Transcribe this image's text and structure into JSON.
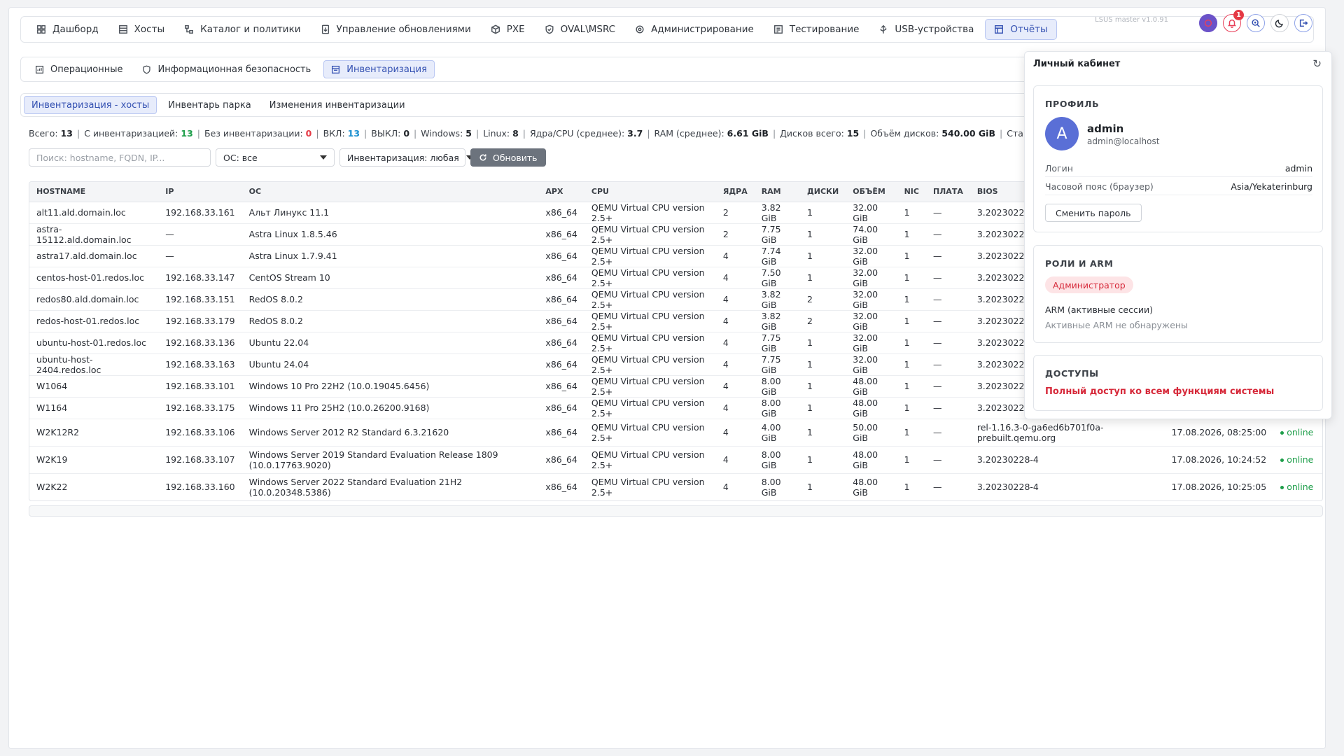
{
  "app": {
    "version": "LSUS master v1.0.91"
  },
  "topnav": [
    {
      "label": "Дашборд",
      "icon": "dashboard-icon"
    },
    {
      "label": "Хосты",
      "icon": "hosts-icon"
    },
    {
      "label": "Каталог и политики",
      "icon": "catalog-icon"
    },
    {
      "label": "Управление обновлениями",
      "icon": "updates-icon"
    },
    {
      "label": "PXE",
      "icon": "pxe-icon"
    },
    {
      "label": "OVAL\\MSRC",
      "icon": "shield-icon"
    },
    {
      "label": "Администрирование",
      "icon": "admin-icon"
    },
    {
      "label": "Тестирование",
      "icon": "testing-icon"
    },
    {
      "label": "USB-устройства",
      "icon": "usb-icon"
    },
    {
      "label": "Отчёты",
      "icon": "reports-icon",
      "active": true
    }
  ],
  "notifications": {
    "count": "1"
  },
  "subnav": [
    {
      "label": "Операционные",
      "icon": "operations-icon"
    },
    {
      "label": "Информационная безопасность",
      "icon": "security-icon"
    },
    {
      "label": "Инвентаризация",
      "icon": "inventory-icon",
      "active": true
    }
  ],
  "tabs": [
    {
      "label": "Инвентаризация - хосты",
      "active": true
    },
    {
      "label": "Инвентарь парка"
    },
    {
      "label": "Изменения инвентаризации"
    }
  ],
  "stats": [
    {
      "label": "Всего:",
      "value": "13",
      "color": ""
    },
    {
      "label": "С инвентаризацией:",
      "value": "13",
      "color": "green"
    },
    {
      "label": "Без инвентаризации:",
      "value": "0",
      "color": "red"
    },
    {
      "label": "ВКЛ:",
      "value": "13",
      "color": "blue"
    },
    {
      "label": "ВЫКЛ:",
      "value": "0",
      "color": ""
    },
    {
      "label": "Windows:",
      "value": "5",
      "color": ""
    },
    {
      "label": "Linux:",
      "value": "8",
      "color": ""
    },
    {
      "label": "Ядра/CPU (среднее):",
      "value": "3.7",
      "color": ""
    },
    {
      "label": "RAM (среднее):",
      "value": "6.61 GiB",
      "color": ""
    },
    {
      "label": "Дисков всего:",
      "value": "15",
      "color": ""
    },
    {
      "label": "Объём дисков:",
      "value": "540.00 GiB",
      "color": ""
    },
    {
      "label": "Старейшая синхр",
      "value": "",
      "color": ""
    }
  ],
  "filters": {
    "search_placeholder": "Поиск: hostname, FQDN, IP...",
    "os_select": "ОС: все",
    "inventory_select": "Инвентаризация: любая",
    "refresh_label": "Обновить"
  },
  "table": {
    "headers": [
      "HOSTNAME",
      "IP",
      "ОС",
      "АРХ",
      "CPU",
      "ЯДРА",
      "RAM",
      "ДИСКИ",
      "ОБЪЁМ",
      "NIC",
      "ПЛАТА",
      "BIOS",
      "",
      ""
    ],
    "rows": [
      [
        "alt11.ald.domain.loc",
        "192.168.33.161",
        "Альт Линукс 11.1",
        "x86_64",
        "QEMU Virtual CPU version 2.5+",
        "2",
        "3.82 GiB",
        "1",
        "32.00 GiB",
        "1",
        "—",
        "3.2023022",
        "",
        ""
      ],
      [
        "astra-15112.ald.domain.loc",
        "—",
        "Astra Linux 1.8.5.46",
        "x86_64",
        "QEMU Virtual CPU version 2.5+",
        "2",
        "7.75 GiB",
        "1",
        "74.00 GiB",
        "1",
        "—",
        "3.2023022",
        "",
        ""
      ],
      [
        "astra17.ald.domain.loc",
        "—",
        "Astra Linux 1.7.9.41",
        "x86_64",
        "QEMU Virtual CPU version 2.5+",
        "4",
        "7.74 GiB",
        "1",
        "32.00 GiB",
        "1",
        "—",
        "3.2023022",
        "",
        ""
      ],
      [
        "centos-host-01.redos.loc",
        "192.168.33.147",
        "CentOS Stream 10",
        "x86_64",
        "QEMU Virtual CPU version 2.5+",
        "4",
        "7.50 GiB",
        "1",
        "32.00 GiB",
        "1",
        "—",
        "3.2023022",
        "",
        ""
      ],
      [
        "redos80.ald.domain.loc",
        "192.168.33.151",
        "RedOS 8.0.2",
        "x86_64",
        "QEMU Virtual CPU version 2.5+",
        "4",
        "3.82 GiB",
        "2",
        "32.00 GiB",
        "1",
        "—",
        "3.2023022",
        "",
        ""
      ],
      [
        "redos-host-01.redos.loc",
        "192.168.33.179",
        "RedOS 8.0.2",
        "x86_64",
        "QEMU Virtual CPU version 2.5+",
        "4",
        "3.82 GiB",
        "2",
        "32.00 GiB",
        "1",
        "—",
        "3.2023022",
        "",
        ""
      ],
      [
        "ubuntu-host-01.redos.loc",
        "192.168.33.136",
        "Ubuntu 22.04",
        "x86_64",
        "QEMU Virtual CPU version 2.5+",
        "4",
        "7.75 GiB",
        "1",
        "32.00 GiB",
        "1",
        "—",
        "3.2023022",
        "",
        ""
      ],
      [
        "ubuntu-host-2404.redos.loc",
        "192.168.33.163",
        "Ubuntu 24.04",
        "x86_64",
        "QEMU Virtual CPU version 2.5+",
        "4",
        "7.75 GiB",
        "1",
        "32.00 GiB",
        "1",
        "—",
        "3.2023022",
        "",
        ""
      ],
      [
        "W1064",
        "192.168.33.101",
        "Windows 10 Pro 22H2 (10.0.19045.6456)",
        "x86_64",
        "QEMU Virtual CPU version 2.5+",
        "4",
        "8.00 GiB",
        "1",
        "48.00 GiB",
        "1",
        "—",
        "3.2023022",
        "",
        ""
      ],
      [
        "W1164",
        "192.168.33.175",
        "Windows 11 Pro 25H2 (10.0.26200.9168)",
        "x86_64",
        "QEMU Virtual CPU version 2.5+",
        "4",
        "8.00 GiB",
        "1",
        "48.00 GiB",
        "1",
        "—",
        "3.2023022",
        "",
        ""
      ],
      [
        "W2K12R2",
        "192.168.33.106",
        "Windows Server 2012 R2 Standard 6.3.21620",
        "x86_64",
        "QEMU Virtual CPU version 2.5+",
        "4",
        "4.00 GiB",
        "1",
        "50.00 GiB",
        "1",
        "—",
        "rel-1.16.3-0-ga6ed6b701f0a-prebuilt.qemu.org",
        "17.08.2026, 08:25:00",
        "online"
      ],
      [
        "W2K19",
        "192.168.33.107",
        "Windows Server 2019 Standard Evaluation Release 1809 (10.0.17763.9020)",
        "x86_64",
        "QEMU Virtual CPU version 2.5+",
        "4",
        "8.00 GiB",
        "1",
        "48.00 GiB",
        "1",
        "—",
        "3.20230228-4",
        "17.08.2026, 10:24:52",
        "online"
      ],
      [
        "W2K22",
        "192.168.33.160",
        "Windows Server 2022 Standard Evaluation 21H2 (10.0.20348.5386)",
        "x86_64",
        "QEMU Virtual CPU version 2.5+",
        "4",
        "8.00 GiB",
        "1",
        "48.00 GiB",
        "1",
        "—",
        "3.20230228-4",
        "17.08.2026, 10:25:05",
        "online"
      ]
    ]
  },
  "profile_panel": {
    "title": "Личный кабинет",
    "profile": {
      "heading": "ПРОФИЛЬ",
      "avatar_letter": "A",
      "name": "admin",
      "email": "admin@localhost",
      "login_label": "Логин",
      "login_value": "admin",
      "tz_label": "Часовой пояс (браузер)",
      "tz_value": "Asia/Yekaterinburg",
      "change_password": "Сменить пароль"
    },
    "roles": {
      "heading": "РОЛИ И ARM",
      "role": "Администратор",
      "arm_heading": "ARM (активные сессии)",
      "arm_value": "Активные ARM не обнаружены"
    },
    "access": {
      "heading": "ДОСТУПЫ",
      "value": "Полный доступ ко всем функциям системы"
    }
  },
  "colors": {
    "accent": "#3451b2",
    "online": "#1e9e4a",
    "danger": "#d62839"
  }
}
